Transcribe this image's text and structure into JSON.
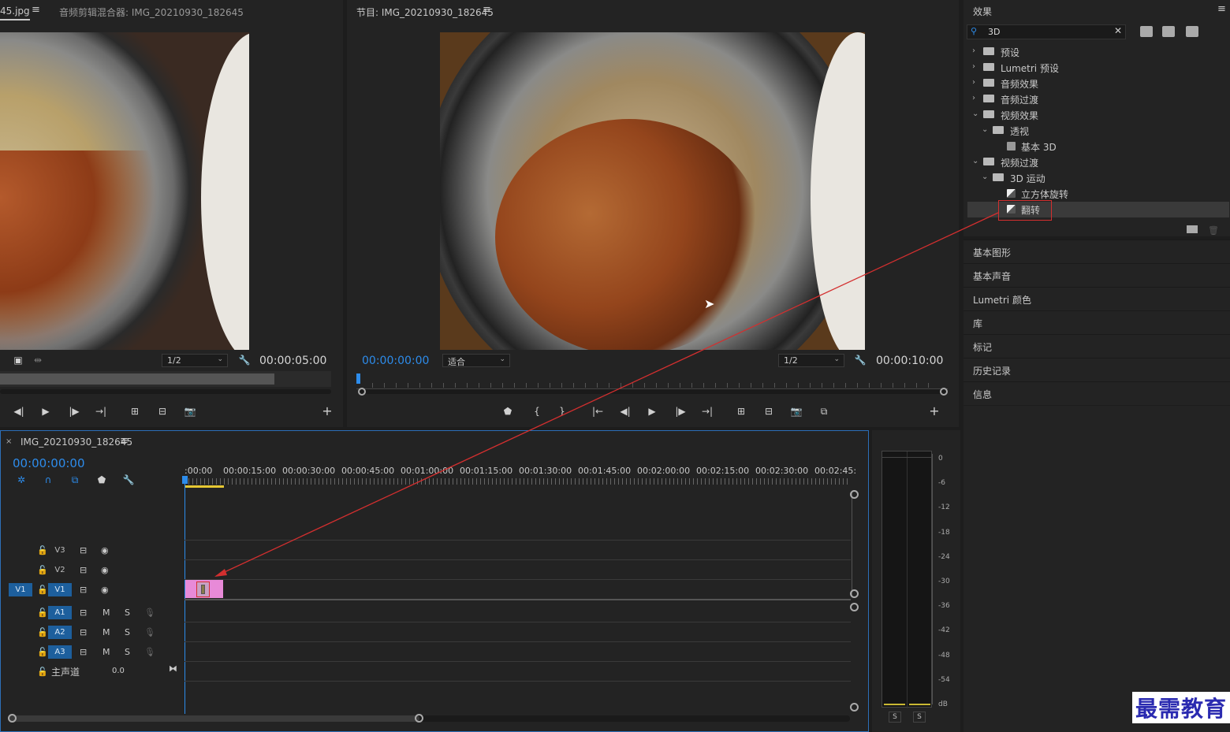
{
  "source_monitor": {
    "tab_filename": "45.jpg",
    "tab_mixer": "音频剪辑混合器: IMG_20210930_182645",
    "resolution": "1/2",
    "duration": "00:00:05:00"
  },
  "program_monitor": {
    "title": "节目: IMG_20210930_182645",
    "timecode": "00:00:00:00",
    "fit": "适合",
    "resolution": "1/2",
    "duration": "00:00:10:00"
  },
  "effects": {
    "title": "效果",
    "search_value": "3D",
    "tree": [
      {
        "label": "预设",
        "type": "folder-star",
        "level": 0,
        "expanded": false
      },
      {
        "label": "Lumetri 预设",
        "type": "folder-star",
        "level": 0,
        "expanded": false
      },
      {
        "label": "音频效果",
        "type": "folder",
        "level": 0,
        "expanded": false
      },
      {
        "label": "音频过渡",
        "type": "folder",
        "level": 0,
        "expanded": false
      },
      {
        "label": "视频效果",
        "type": "folder",
        "level": 0,
        "expanded": true
      },
      {
        "label": "透视",
        "type": "folder",
        "level": 1,
        "expanded": true
      },
      {
        "label": "基本 3D",
        "type": "effect",
        "level": 2
      },
      {
        "label": "视频过渡",
        "type": "folder",
        "level": 0,
        "expanded": true
      },
      {
        "label": "3D 运动",
        "type": "folder",
        "level": 1,
        "expanded": true
      },
      {
        "label": "立方体旋转",
        "type": "transition",
        "level": 2
      },
      {
        "label": "翻转",
        "type": "transition",
        "level": 2,
        "selected": true
      }
    ]
  },
  "panels": [
    "基本图形",
    "基本声音",
    "Lumetri 颜色",
    "库",
    "标记",
    "历史记录",
    "信息"
  ],
  "timeline": {
    "sequence_name": "IMG_20210930_182645",
    "timecode": "00:00:00:00",
    "ruler": [
      ":00:00",
      "00:00:15:00",
      "00:00:30:00",
      "00:00:45:00",
      "00:01:00:00",
      "00:01:15:00",
      "00:01:30:00",
      "00:01:45:00",
      "00:02:00:00",
      "00:02:15:00",
      "00:02:30:00",
      "00:02:45:"
    ],
    "video_tracks": [
      {
        "label": "V3",
        "source": ""
      },
      {
        "label": "V2",
        "source": ""
      },
      {
        "label": "V1",
        "source": "V1"
      }
    ],
    "audio_tracks": [
      {
        "label": "A1",
        "m": "M",
        "s": "S"
      },
      {
        "label": "A2",
        "m": "M",
        "s": "S"
      },
      {
        "label": "A3",
        "m": "M",
        "s": "S"
      }
    ],
    "master_label": "主声道",
    "master_value": "0.0"
  },
  "meter": {
    "scale": [
      "0",
      "-6",
      "-12",
      "-18",
      "-24",
      "-30",
      "-36",
      "-42",
      "-48",
      "-54",
      "dB"
    ],
    "solo_left": "S",
    "solo_right": "S"
  },
  "watermark": "最需教育",
  "colors": {
    "accent": "#2d8ceb",
    "clip": "#e88ad8",
    "highlight": "#d32f2f"
  }
}
